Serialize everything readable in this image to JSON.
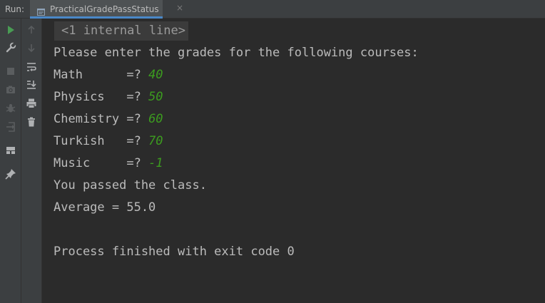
{
  "tabbar": {
    "run_label": "Run:",
    "tab_title": "PracticalGradePassStatus",
    "close_glyph": "×"
  },
  "toolbar_icons": {
    "left": [
      "play-icon",
      "wrench-icon",
      "stop-icon",
      "camera-icon",
      "debug-icon",
      "login-icon",
      "layout-icon",
      "pin-icon"
    ],
    "right": [
      "arrow-up-icon",
      "arrow-down-icon",
      "soft-wrap-icon",
      "scroll-to-end-icon",
      "print-icon",
      "trash-icon"
    ]
  },
  "console": {
    "internal_line": "<1 internal line>",
    "prompt": "Please enter the grades for the following courses:",
    "entries": [
      {
        "label": "Math      =? ",
        "value": "40"
      },
      {
        "label": "Physics   =? ",
        "value": "50"
      },
      {
        "label": "Chemistry =? ",
        "value": "60"
      },
      {
        "label": "Turkish   =? ",
        "value": "70"
      },
      {
        "label": "Music     =? ",
        "value": "-1"
      }
    ],
    "result": "You passed the class.",
    "average": "Average = 55.0",
    "exit": "Process finished with exit code 0"
  },
  "colors": {
    "background": "#2b2b2b",
    "panel": "#3c3f41",
    "text": "#bbbbbb",
    "input": "#3c9c1f",
    "run_green": "#499c54",
    "tab_underline": "#4a88c7"
  }
}
